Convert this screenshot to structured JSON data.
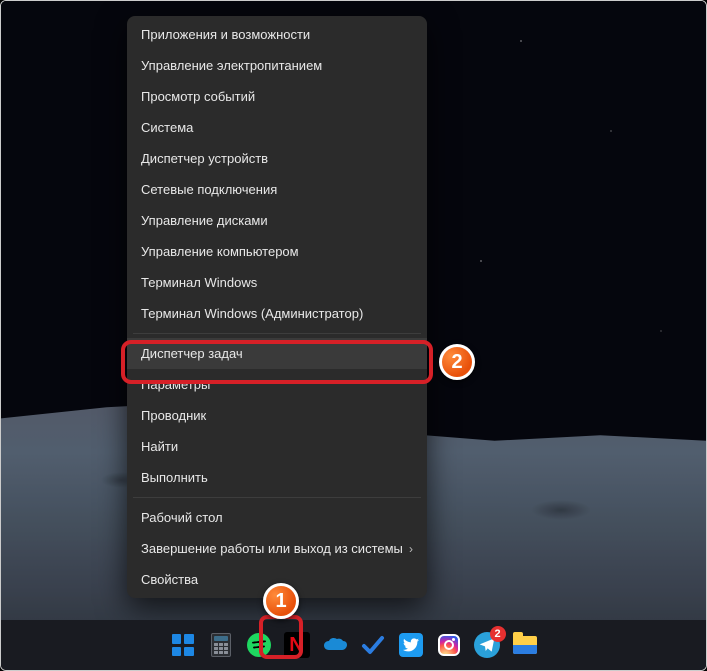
{
  "menu": {
    "items": [
      "Приложения и возможности",
      "Управление электропитанием",
      "Просмотр событий",
      "Система",
      "Диспетчер устройств",
      "Сетевые подключения",
      "Управление дисками",
      "Управление компьютером",
      "Терминал Windows",
      "Терминал Windows (Администратор)",
      "Диспетчер задач",
      "Параметры",
      "Проводник",
      "Найти",
      "Выполнить",
      "Рабочий стол",
      "Завершение работы или выход из системы",
      "Свойства"
    ]
  },
  "annotations": {
    "badge1": "1",
    "badge2": "2"
  },
  "taskbar": {
    "telegram_badge": "2",
    "netflix_letter": "N"
  }
}
